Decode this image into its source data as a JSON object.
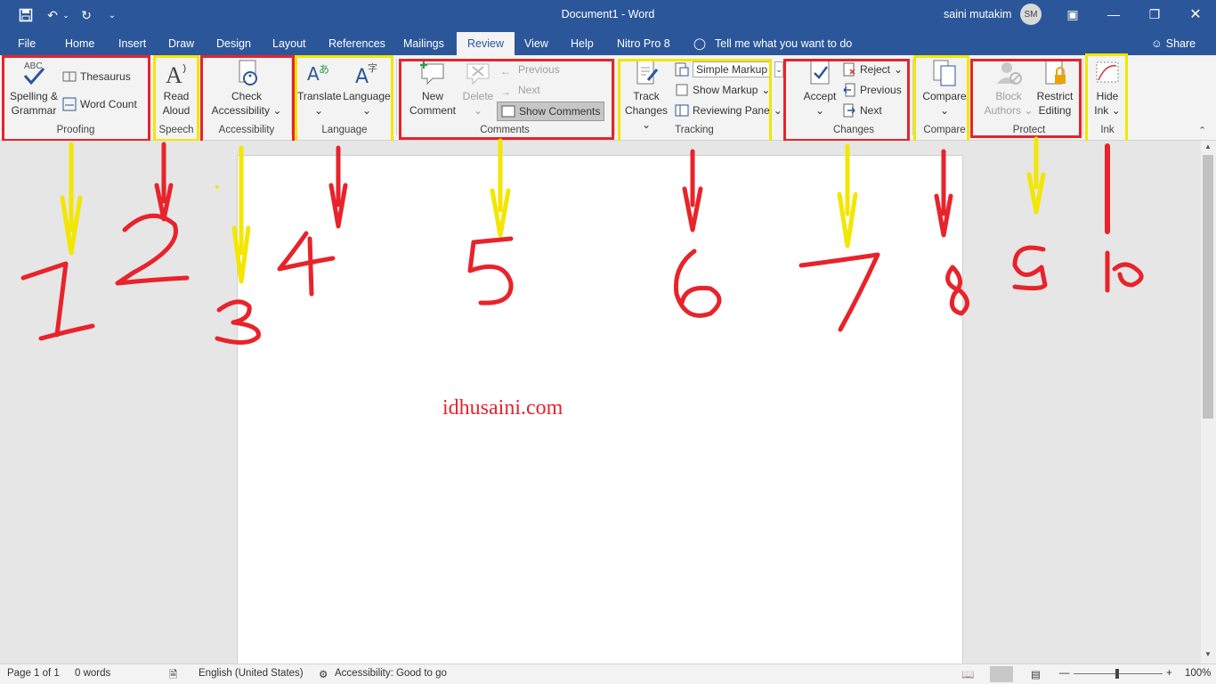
{
  "window": {
    "doc_title": "Document1 - Word",
    "user_name": "saini mutakim",
    "avatar_initials": "SM"
  },
  "tabs": [
    "File",
    "Home",
    "Insert",
    "Draw",
    "Design",
    "Layout",
    "References",
    "Mailings",
    "Review",
    "View",
    "Help",
    "Nitro Pro 8"
  ],
  "active_tab": "Review",
  "tell_me": "Tell me what you want to do",
  "share_label": "Share",
  "ribbon": {
    "proofing": {
      "spelling": "Spelling &",
      "grammar": "Grammar",
      "thesaurus": "Thesaurus",
      "word_count": "Word Count",
      "label": "Proofing",
      "icon_text": "ABC"
    },
    "speech": {
      "read": "Read",
      "aloud": "Aloud",
      "label": "Speech"
    },
    "accessibility": {
      "check": "Check",
      "accessibility": "Accessibility",
      "label": "Accessibility"
    },
    "language": {
      "translate": "Translate",
      "language": "Language",
      "label": "Language"
    },
    "comments": {
      "new": "New",
      "comment": "Comment",
      "delete": "Delete",
      "previous": "Previous",
      "next": "Next",
      "show_comments": "Show Comments",
      "label": "Comments"
    },
    "tracking": {
      "track": "Track",
      "changes": "Changes",
      "simple_markup": "Simple Markup",
      "show_markup": "Show Markup",
      "reviewing_pane": "Reviewing Pane",
      "label": "Tracking"
    },
    "changes": {
      "accept": "Accept",
      "reject": "Reject",
      "previous": "Previous",
      "next": "Next",
      "label": "Changes"
    },
    "compare": {
      "compare": "Compare",
      "label": "Compare"
    },
    "protect": {
      "block": "Block",
      "authors": "Authors",
      "restrict": "Restrict",
      "editing": "Editing",
      "label": "Protect"
    },
    "ink": {
      "hide": "Hide",
      "ink": "Ink",
      "label": "Ink"
    }
  },
  "annotations": {
    "numbers": [
      "1",
      "2",
      "3",
      "4",
      "5",
      "6",
      "7",
      "8",
      "9",
      "10"
    ]
  },
  "document": {
    "watermark": "idhusaini.com"
  },
  "status": {
    "page": "Page 1 of 1",
    "words": "0 words",
    "language": "English (United States)",
    "accessibility": "Accessibility: Good to go",
    "zoom": "100%"
  },
  "colors": {
    "accent": "#2b579a",
    "annotation_red": "#e8232b",
    "annotation_yellow": "#f3e600"
  }
}
